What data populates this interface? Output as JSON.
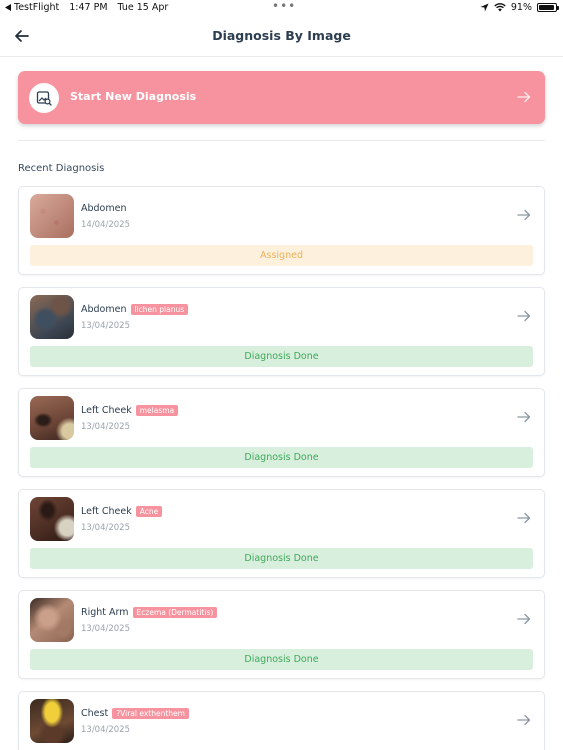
{
  "status_bar": {
    "app": "TestFlight",
    "time": "1:47 PM",
    "date": "Tue 15 Apr",
    "battery": "91%"
  },
  "nav": {
    "title": "Diagnosis By Image"
  },
  "start": {
    "label": "Start New Diagnosis"
  },
  "section": {
    "title": "Recent Diagnosis"
  },
  "colors": {
    "accent": "#f7939e",
    "assigned_bg": "#fdf0dc",
    "assigned_text": "#eab25a",
    "done_bg": "#d9efdd",
    "done_text": "#3ea95a"
  },
  "diagnoses": [
    {
      "site": "Abdomen",
      "tag": "",
      "date": "14/04/2025",
      "status": "Assigned",
      "state": "assigned"
    },
    {
      "site": "Abdomen",
      "tag": "lichen planus",
      "date": "13/04/2025",
      "status": "Diagnosis Done",
      "state": "done"
    },
    {
      "site": "Left Cheek",
      "tag": "melasma",
      "date": "13/04/2025",
      "status": "Diagnosis Done",
      "state": "done"
    },
    {
      "site": "Left Cheek",
      "tag": "Acne",
      "date": "13/04/2025",
      "status": "Diagnosis Done",
      "state": "done"
    },
    {
      "site": "Right Arm",
      "tag": "Eczema (Dermatitis)",
      "date": "13/04/2025",
      "status": "Diagnosis Done",
      "state": "done"
    },
    {
      "site": "Chest",
      "tag": "?Viral exthenthem",
      "date": "13/04/2025",
      "status": "",
      "state": ""
    }
  ]
}
